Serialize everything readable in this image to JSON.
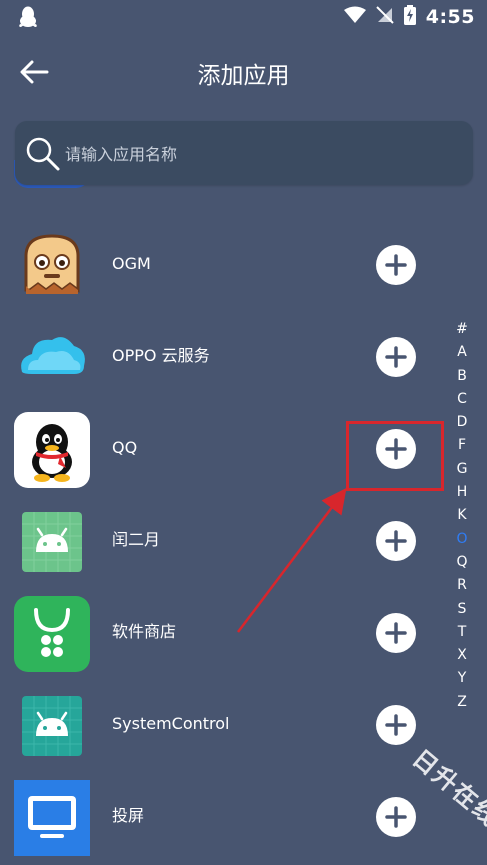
{
  "status_bar": {
    "time": "4:55"
  },
  "header": {
    "title": "添加应用"
  },
  "search": {
    "placeholder": "请输入应用名称"
  },
  "apps": [
    {
      "label": ""
    },
    {
      "label": "OGM"
    },
    {
      "label": "OPPO 云服务"
    },
    {
      "label": "QQ"
    },
    {
      "label": "闰二月"
    },
    {
      "label": "软件商店"
    },
    {
      "label": "SystemControl"
    },
    {
      "label": "投屏"
    }
  ],
  "alphabet_index": [
    "#",
    "A",
    "B",
    "C",
    "D",
    "F",
    "G",
    "H",
    "K",
    "O",
    "Q",
    "R",
    "S",
    "T",
    "X",
    "Y",
    "Z"
  ],
  "alphabet_active": "O",
  "watermark": "日升在线",
  "colors": {
    "background": "#485570",
    "search_bg": "#3b4b61",
    "highlight_red": "#d8262c",
    "index_active": "#2f7df6"
  }
}
